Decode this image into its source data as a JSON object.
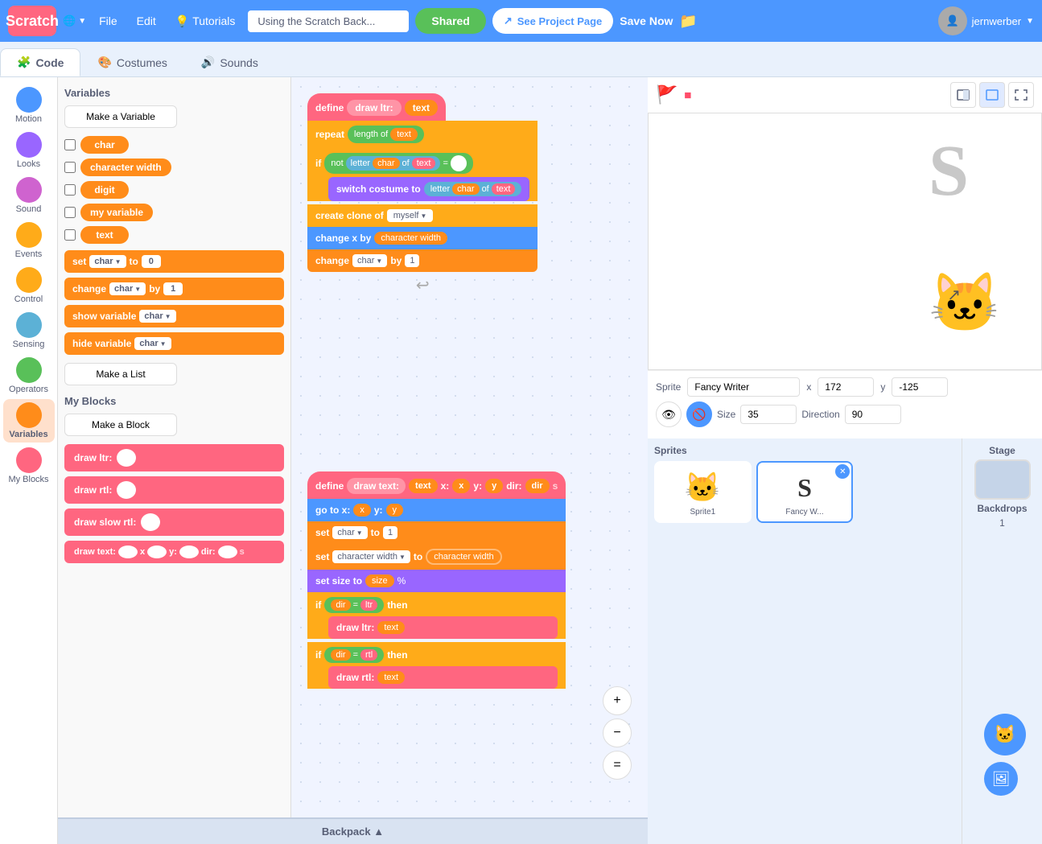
{
  "navbar": {
    "logo": "Scratch",
    "globe_label": "🌐",
    "file_label": "File",
    "edit_label": "Edit",
    "tutorials_icon": "💡",
    "tutorials_label": "Tutorials",
    "project_title": "Using the Scratch Back...",
    "shared_label": "Shared",
    "see_project_label": "See Project Page",
    "save_label": "Save Now",
    "user_name": "jernwerber"
  },
  "tabs": [
    {
      "id": "code",
      "label": "Code",
      "icon": "🧩",
      "active": true
    },
    {
      "id": "costumes",
      "label": "Costumes",
      "icon": "🎨",
      "active": false
    },
    {
      "id": "sounds",
      "label": "Sounds",
      "icon": "🔊",
      "active": false
    }
  ],
  "categories": [
    {
      "id": "motion",
      "label": "Motion",
      "color": "#4c97ff"
    },
    {
      "id": "looks",
      "label": "Looks",
      "color": "#9966ff"
    },
    {
      "id": "sound",
      "label": "Sound",
      "color": "#cf63cf"
    },
    {
      "id": "events",
      "label": "Events",
      "color": "#ffab19"
    },
    {
      "id": "control",
      "label": "Control",
      "color": "#ffab19"
    },
    {
      "id": "sensing",
      "label": "Sensing",
      "color": "#5cb1d6"
    },
    {
      "id": "operators",
      "label": "Operators",
      "color": "#59c059"
    },
    {
      "id": "variables",
      "label": "Variables",
      "color": "#ff8c1a",
      "active": true
    },
    {
      "id": "myblocks",
      "label": "My Blocks",
      "color": "#ff6680"
    }
  ],
  "variables_section": {
    "title": "Variables",
    "make_variable_btn": "Make a Variable",
    "variables": [
      {
        "name": "char"
      },
      {
        "name": "character width"
      },
      {
        "name": "digit"
      },
      {
        "name": "my variable"
      },
      {
        "name": "text"
      }
    ],
    "make_list_btn": "Make a List"
  },
  "my_blocks_section": {
    "title": "My Blocks",
    "make_block_btn": "Make a Block",
    "blocks": [
      {
        "name": "draw ltr:",
        "has_input": true
      },
      {
        "name": "draw rtl:",
        "has_input": true
      },
      {
        "name": "draw slow rtl:",
        "has_input": true
      },
      {
        "name": "draw text:",
        "has_inputs": true,
        "params": "x y: dir:"
      }
    ]
  },
  "code_blocks_group1": {
    "define_label": "define",
    "define_name": "draw ltr:",
    "define_param": "text",
    "blocks": [
      {
        "type": "control",
        "text": "repeat",
        "arg": "length of",
        "arg2": "text"
      },
      {
        "type": "if",
        "condition": "not",
        "cond_detail": "letter char of text =",
        "body": [
          {
            "type": "looks",
            "text": "switch costume to",
            "arg": "letter char of text"
          }
        ]
      },
      {
        "type": "control",
        "text": "create clone of",
        "arg": "myself"
      },
      {
        "type": "motion",
        "text": "change x by",
        "arg": "character width"
      },
      {
        "type": "var",
        "text": "change",
        "arg": "char",
        "by": "1"
      }
    ]
  },
  "code_blocks_group2": {
    "define_label": "define",
    "define_name": "draw text:",
    "params": "text x: x y: y dir: dir",
    "blocks": [
      {
        "type": "motion",
        "text": "go to x:",
        "x": "x",
        "y": "y"
      },
      {
        "type": "var",
        "text": "set char to",
        "val": "1"
      },
      {
        "type": "var",
        "text": "set character width to",
        "val2": "character width"
      },
      {
        "type": "looks",
        "text": "set size to",
        "arg": "size",
        "suffix": "%"
      },
      {
        "type": "if",
        "condition": "dir = ltr",
        "body": [
          {
            "type": "myblock",
            "text": "draw ltr:",
            "arg": "text"
          }
        ]
      },
      {
        "type": "if",
        "condition": "dir = rtl",
        "body": [
          {
            "type": "myblock",
            "text": "draw rtl:",
            "arg": "text"
          }
        ]
      }
    ]
  },
  "stage": {
    "sprite_label": "Sprite",
    "sprite_name": "Fancy Writer",
    "x_label": "x",
    "x_value": "172",
    "y_label": "y",
    "y_value": "-125",
    "size_label": "Size",
    "size_value": "35",
    "direction_label": "Direction",
    "direction_value": "90",
    "stage_label": "Stage",
    "backdrops_label": "Backdrops",
    "backdrops_count": "1"
  },
  "sprites": [
    {
      "id": "sprite1",
      "label": "Sprite1",
      "emoji": "🐱",
      "active": false
    },
    {
      "id": "fancywriter",
      "label": "Fancy W...",
      "letter": "S",
      "active": true
    }
  ],
  "zoom_controls": {
    "zoom_in": "+",
    "zoom_out": "−",
    "reset": "="
  },
  "backpack_label": "Backpack"
}
